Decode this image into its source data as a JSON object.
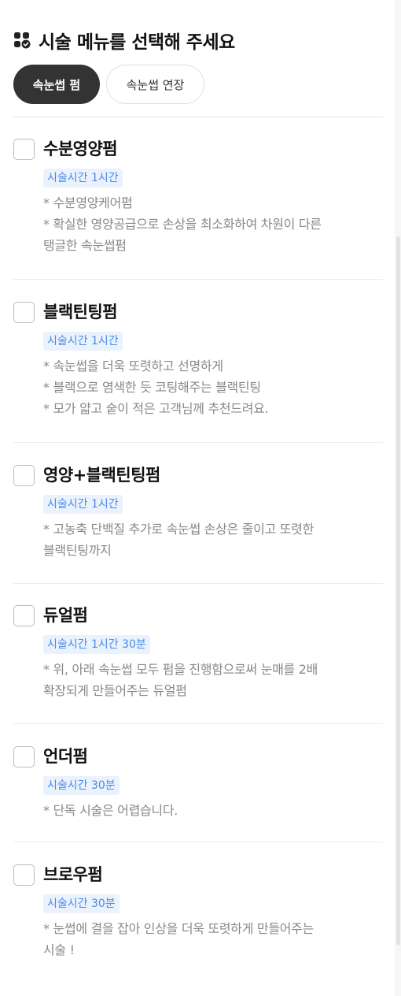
{
  "heading": {
    "title": "시술 메뉴를 선택해 주세요",
    "icon": "menu-check-icon"
  },
  "tabs": [
    {
      "label": "속눈썹 펌",
      "active": true
    },
    {
      "label": "속눈썹 연장",
      "active": false
    }
  ],
  "items": [
    {
      "title": "수분영양펌",
      "duration": "시술시간 1시간",
      "desc": [
        "* 수분영양케어펌",
        "* 확실한 영양공급으로 손상을 최소화하여 차원이 다른",
        "탱글한 속눈썹펌"
      ]
    },
    {
      "title": "블랙틴팅펌",
      "duration": "시술시간 1시간",
      "desc": [
        "* 속눈썹을 더욱 또렷하고 선명하게",
        "* 블랙으로 염색한 듯 코팅해주는 블랙틴팅",
        "* 모가 얇고 숱이 적은 고객님께 추천드려요."
      ]
    },
    {
      "title": "영양+블랙틴팅펌",
      "duration": "시술시간 1시간",
      "desc": [
        "* 고농축 단백질 추가로 속눈썹 손상은 줄이고 또렷한",
        "블랙틴팅까지"
      ]
    },
    {
      "title": "듀얼펌",
      "duration": "시술시간 1시간 30분",
      "desc": [
        "* 위, 아래 속눈썹 모두 펌을 진행함으로써 눈매를 2배",
        "확장되게 만들어주는 듀얼펌"
      ]
    },
    {
      "title": "언더펌",
      "duration": "시술시간 30분",
      "desc": [
        "* 단독 시술은 어렵습니다."
      ]
    },
    {
      "title": "브로우펌",
      "duration": "시술시간 30분",
      "desc": [
        "* 눈썹에 결을 잡아 인상을 더욱 또렷하게 만들어주는",
        "시술 !"
      ]
    }
  ]
}
